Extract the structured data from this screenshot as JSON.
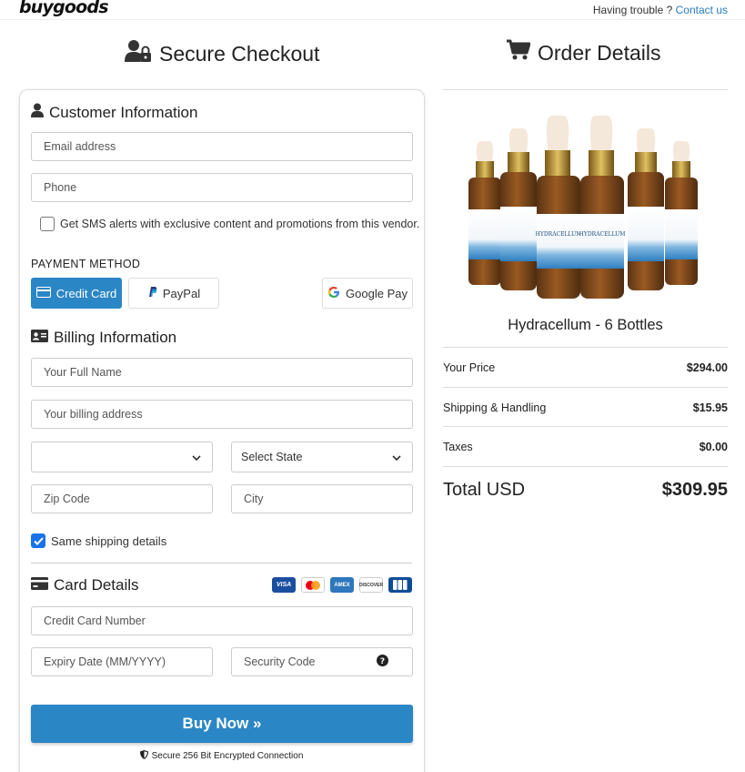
{
  "header": {
    "logo": "buygoods",
    "help_text": "Having trouble ?",
    "help_link": "Contact us"
  },
  "checkout": {
    "title": "Secure Checkout",
    "customer": {
      "title": "Customer Information",
      "email_placeholder": "Email address",
      "phone_placeholder": "Phone",
      "sms_label": "Get SMS alerts with exclusive content and promotions from this vendor.",
      "sms_checked": false
    },
    "payment": {
      "label": "PAYMENT METHOD",
      "methods": [
        "Credit Card",
        "PayPal",
        "Google Pay"
      ],
      "selected": "Credit Card"
    },
    "billing": {
      "title": "Billing Information",
      "name_placeholder": "Your Full Name",
      "address_placeholder": "Your billing address",
      "country_value": "",
      "state_value": "Select State",
      "zip_placeholder": "Zip Code",
      "city_placeholder": "City",
      "same_shipping_label": "Same shipping details",
      "same_shipping_checked": true
    },
    "card": {
      "title": "Card Details",
      "brands": [
        "VISA",
        "MC",
        "AMEX",
        "DISCOVER",
        "JCB"
      ],
      "number_placeholder": "Credit Card Number",
      "expiry_placeholder": "Expiry Date (MM/YYYY)",
      "cvv_placeholder": "Security Code"
    },
    "buy_label": "Buy Now »",
    "secure_note": "Secure 256 Bit Encrypted Connection"
  },
  "order": {
    "title": "Order Details",
    "product_name": "Hydracellum - 6 Bottles",
    "bottle_label": "HYDRACELLUM",
    "lines": [
      {
        "label": "Your Price",
        "value": "$294.00"
      },
      {
        "label": "Shipping & Handling",
        "value": "$15.95"
      },
      {
        "label": "Taxes",
        "value": "$0.00"
      }
    ],
    "total_label": "Total USD",
    "total_value": "$309.95"
  },
  "colors": {
    "accent": "#2b86c5",
    "link": "#2a7bbf",
    "checkbox": "#1a73e8"
  }
}
